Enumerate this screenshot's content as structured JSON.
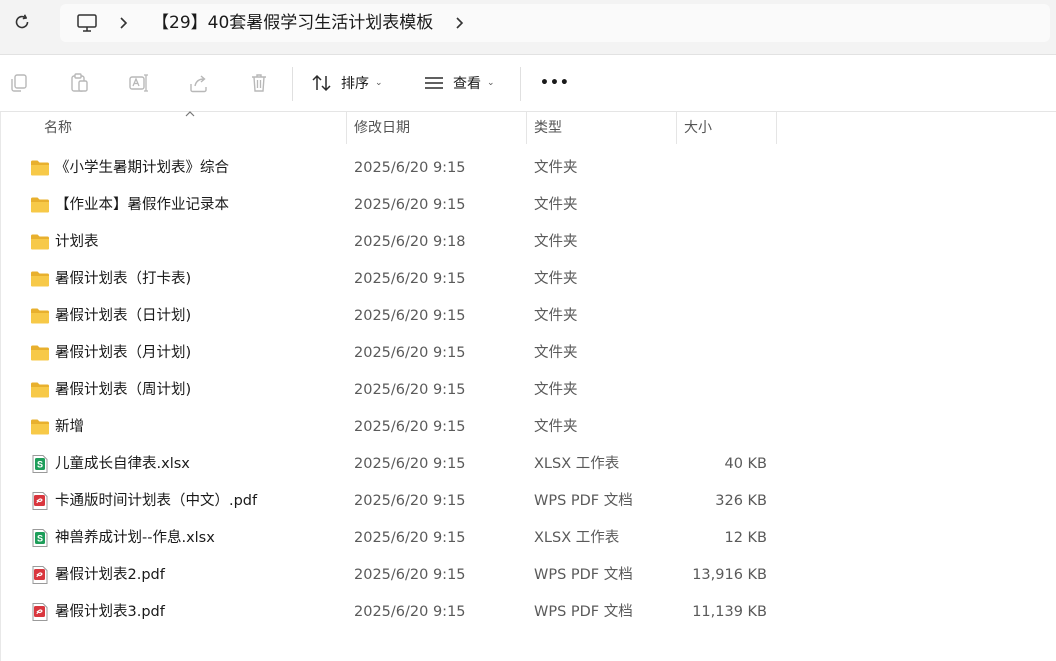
{
  "address": {
    "path": "【29】40套暑假学习生活计划表模板"
  },
  "toolbar": {
    "icons": [
      "copy-icon",
      "paste-icon",
      "rename-icon",
      "share-icon",
      "delete-icon"
    ],
    "sort_label": "排序",
    "view_label": "查看",
    "more_label": "•••"
  },
  "columns": {
    "name": "名称",
    "date": "修改日期",
    "type": "类型",
    "size": "大小"
  },
  "files": [
    {
      "name": "《小学生暑期计划表》综合",
      "date": "2025/6/20 9:15",
      "type": "文件夹",
      "size": "",
      "kind": "folder"
    },
    {
      "name": "【作业本】暑假作业记录本",
      "date": "2025/6/20 9:15",
      "type": "文件夹",
      "size": "",
      "kind": "folder"
    },
    {
      "name": "计划表",
      "date": "2025/6/20 9:18",
      "type": "文件夹",
      "size": "",
      "kind": "folder"
    },
    {
      "name": "暑假计划表（打卡表)",
      "date": "2025/6/20 9:15",
      "type": "文件夹",
      "size": "",
      "kind": "folder"
    },
    {
      "name": "暑假计划表（日计划)",
      "date": "2025/6/20 9:15",
      "type": "文件夹",
      "size": "",
      "kind": "folder"
    },
    {
      "name": "暑假计划表（月计划)",
      "date": "2025/6/20 9:15",
      "type": "文件夹",
      "size": "",
      "kind": "folder"
    },
    {
      "name": "暑假计划表（周计划)",
      "date": "2025/6/20 9:15",
      "type": "文件夹",
      "size": "",
      "kind": "folder"
    },
    {
      "name": "新增",
      "date": "2025/6/20 9:15",
      "type": "文件夹",
      "size": "",
      "kind": "folder"
    },
    {
      "name": "儿童成长自律表.xlsx",
      "date": "2025/6/20 9:15",
      "type": "XLSX 工作表",
      "size": "40 KB",
      "kind": "xlsx"
    },
    {
      "name": "卡通版时间计划表（中文）.pdf",
      "date": "2025/6/20 9:15",
      "type": "WPS PDF 文档",
      "size": "326 KB",
      "kind": "pdf"
    },
    {
      "name": "神兽养成计划--作息.xlsx",
      "date": "2025/6/20 9:15",
      "type": "XLSX 工作表",
      "size": "12 KB",
      "kind": "xlsx"
    },
    {
      "name": "暑假计划表2.pdf",
      "date": "2025/6/20 9:15",
      "type": "WPS PDF 文档",
      "size": "13,916 KB",
      "kind": "pdf"
    },
    {
      "name": "暑假计划表3.pdf",
      "date": "2025/6/20 9:15",
      "type": "WPS PDF 文档",
      "size": "11,139 KB",
      "kind": "pdf"
    }
  ],
  "colors": {
    "folder": "#f7c948",
    "folder_dark": "#e8b02e",
    "xlsx": "#1e9e5a",
    "pdf": "#d9363e",
    "accent": "#0067c0"
  }
}
